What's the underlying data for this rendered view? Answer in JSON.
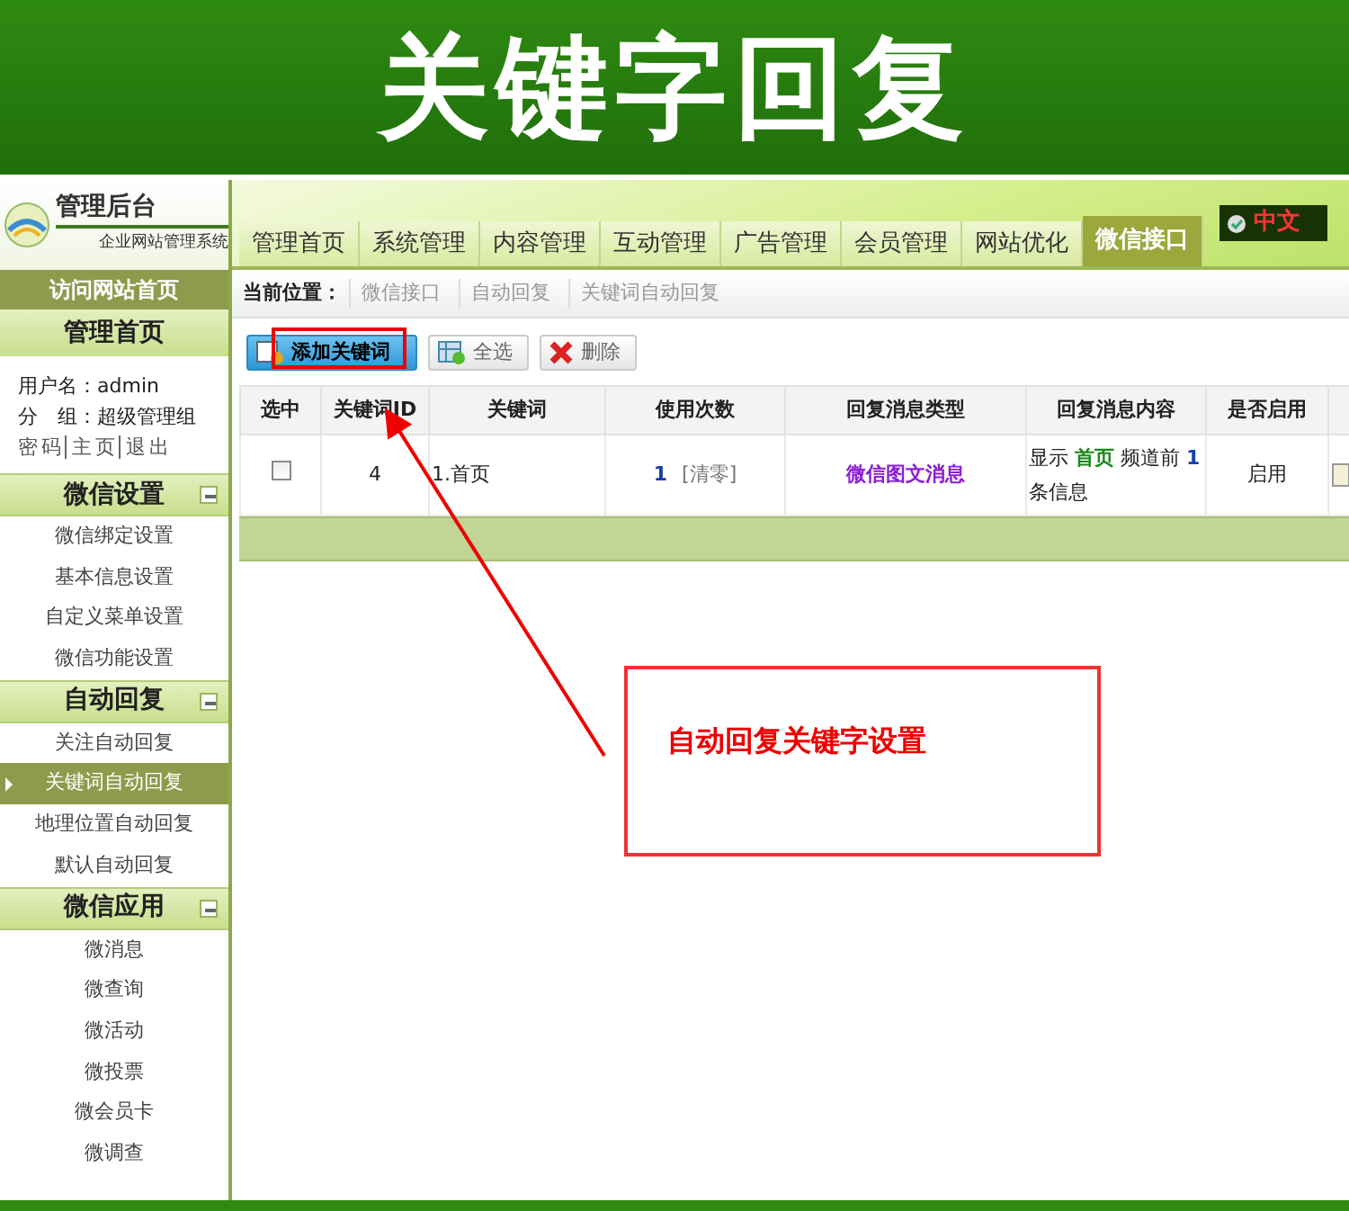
{
  "banner": {
    "title": "关键字回复"
  },
  "sidebar": {
    "brand": {
      "title": "管理后台",
      "subtitle": "企业网站管理系统"
    },
    "visit_link": "访问网站首页",
    "home_header": "管理首页",
    "user_lines": [
      "用户名：admin",
      "分　组：超级管理组"
    ],
    "user_links": [
      "密码",
      "主页",
      "退出"
    ],
    "sections": [
      {
        "title": "微信设置",
        "expanded": true,
        "items": [
          {
            "label": "微信绑定设置",
            "selected": false
          },
          {
            "label": "基本信息设置",
            "selected": false
          },
          {
            "label": "自定义菜单设置",
            "selected": false
          },
          {
            "label": "微信功能设置",
            "selected": false
          }
        ]
      },
      {
        "title": "自动回复",
        "expanded": true,
        "items": [
          {
            "label": "关注自动回复",
            "selected": false
          },
          {
            "label": "关键词自动回复",
            "selected": true
          },
          {
            "label": "地理位置自动回复",
            "selected": false
          },
          {
            "label": "默认自动回复",
            "selected": false
          }
        ]
      },
      {
        "title": "微信应用",
        "expanded": true,
        "items": [
          {
            "label": "微消息",
            "selected": false
          },
          {
            "label": "微查询",
            "selected": false
          },
          {
            "label": "微活动",
            "selected": false
          },
          {
            "label": "微投票",
            "selected": false
          },
          {
            "label": "微会员卡",
            "selected": false
          },
          {
            "label": "微调查",
            "selected": false
          }
        ]
      }
    ]
  },
  "tabs": [
    {
      "label": "管理首页",
      "selected": false
    },
    {
      "label": "系统管理",
      "selected": false
    },
    {
      "label": "内容管理",
      "selected": false
    },
    {
      "label": "互动管理",
      "selected": false
    },
    {
      "label": "广告管理",
      "selected": false
    },
    {
      "label": "会员管理",
      "selected": false
    },
    {
      "label": "网站优化",
      "selected": false
    },
    {
      "label": "微信接口",
      "selected": true
    }
  ],
  "language_button": {
    "label": "中文"
  },
  "breadcrumb": {
    "label": "当前位置：",
    "items": [
      "微信接口",
      "自动回复",
      "关键词自动回复"
    ]
  },
  "toolbar": [
    {
      "kind": "add",
      "label": "添加关键词"
    },
    {
      "kind": "select_all",
      "label": "全选"
    },
    {
      "kind": "delete",
      "label": "删除"
    }
  ],
  "table": {
    "columns": [
      "选中",
      "关键词ID",
      "关键词",
      "使用次数",
      "回复消息类型",
      "回复消息内容",
      "是否启用"
    ],
    "rows": [
      {
        "checked": false,
        "id": "4",
        "keyword": "1.首页",
        "count": "1",
        "reset": "[清零]",
        "type": "微信图文消息",
        "content": [
          {
            "kind": "plain",
            "text": "显示 "
          },
          {
            "kind": "page",
            "text": "首页"
          },
          {
            "kind": "plain",
            "text": " 频道前 "
          },
          {
            "kind": "number",
            "text": "1"
          },
          {
            "kind": "plain",
            "text": " 条信息"
          }
        ],
        "enabled": "启用"
      }
    ]
  },
  "annotation": {
    "label": "自动回复关键字设置"
  }
}
